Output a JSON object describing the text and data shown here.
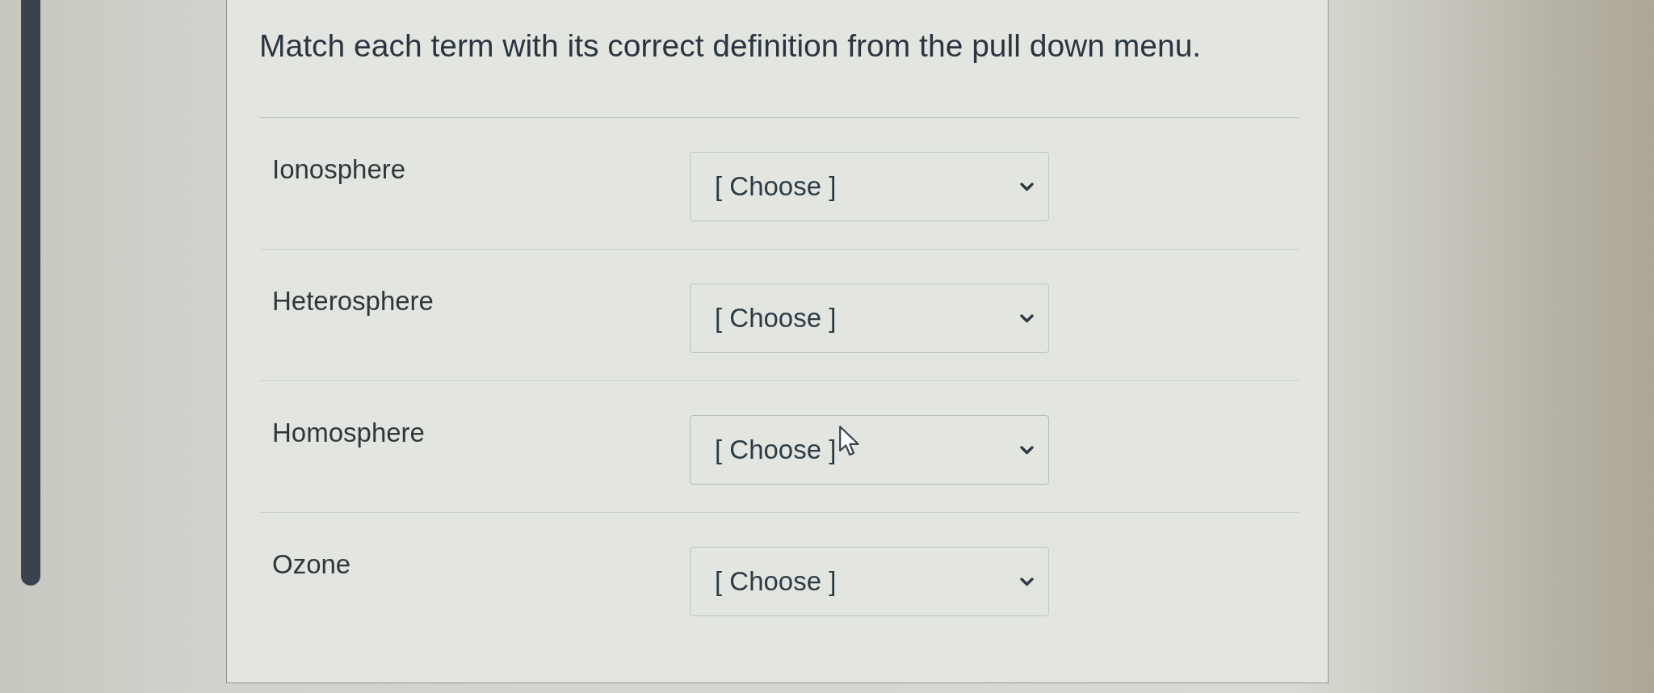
{
  "instructions": "Match each term with its correct definition from the pull down menu.",
  "rows": [
    {
      "term": "Ionosphere",
      "dropdown": {
        "value": "[ Choose ]",
        "hovered": false
      }
    },
    {
      "term": "Heterosphere",
      "dropdown": {
        "value": "[ Choose ]",
        "hovered": false
      }
    },
    {
      "term": "Homosphere",
      "dropdown": {
        "value": "[ Choose ]",
        "hovered": true
      }
    },
    {
      "term": "Ozone",
      "dropdown": {
        "value": "[ Choose ]",
        "hovered": false
      }
    }
  ]
}
